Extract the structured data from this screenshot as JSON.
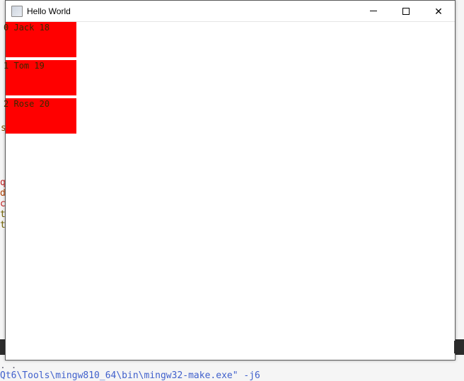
{
  "window": {
    "title": "Hello World"
  },
  "bg": {
    "line_dots": ". .",
    "line_make": "Qt6\\Tools\\mingw810_64\\bin\\mingw32-make.exe\" -j6",
    "frag_q": "q",
    "frag_d": "d",
    "frag_c": "c",
    "frag_t": "t",
    "frag_t2": "t",
    "frag_s": "s"
  },
  "items": [
    {
      "index": "0",
      "name": "Jack",
      "age": "18"
    },
    {
      "index": "1",
      "name": "Tom",
      "age": "19"
    },
    {
      "index": "2",
      "name": "Rose",
      "age": "20"
    }
  ]
}
